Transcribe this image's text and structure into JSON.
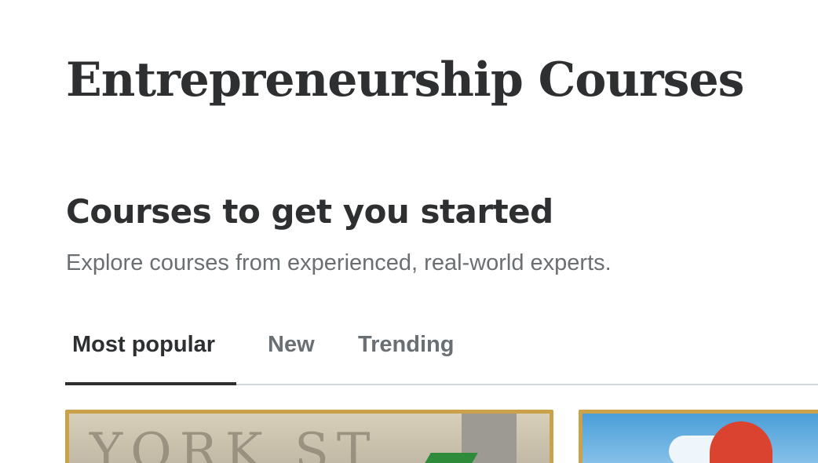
{
  "page": {
    "title": "Entrepreneurship Courses"
  },
  "section": {
    "title": "Courses to get you started",
    "subtitle": "Explore courses from experienced, real-world experts."
  },
  "tabs": [
    {
      "label": "Most popular",
      "active": true
    },
    {
      "label": "New",
      "active": false
    },
    {
      "label": "Trending",
      "active": false
    }
  ],
  "cards": [
    {
      "thumbnail_icon": "course-thumbnail-image",
      "thumbnail_text": "YORK ST"
    },
    {
      "thumbnail_icon": "course-thumbnail-image"
    }
  ],
  "colors": {
    "text_primary": "#2d2f31",
    "text_secondary": "#6a6f73",
    "divider": "#d1d7dc",
    "thumbnail_border": "#c9a24a"
  }
}
